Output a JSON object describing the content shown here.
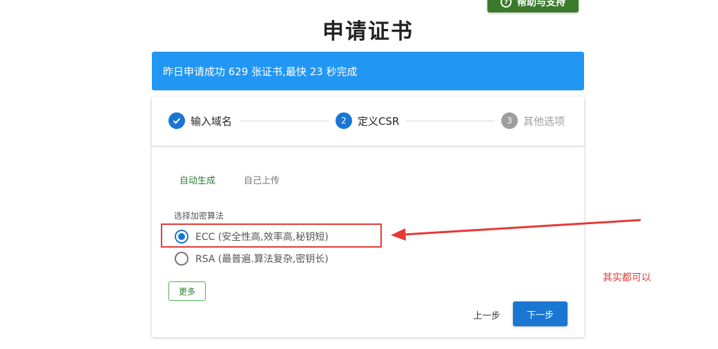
{
  "header": {
    "help_button": "帮助与支持",
    "title": "申请证书"
  },
  "banner": {
    "text": "昨日申请成功 629 张证书,最快 23 秒完成"
  },
  "stepper": {
    "steps": [
      {
        "index": "1",
        "label": "输入域名",
        "state": "done"
      },
      {
        "index": "2",
        "label": "定义CSR",
        "state": "active"
      },
      {
        "index": "3",
        "label": "其他选项",
        "state": "todo"
      }
    ]
  },
  "tabs": [
    {
      "label": "自动生成",
      "selected": true
    },
    {
      "label": "自己上传",
      "selected": false
    }
  ],
  "algorithm": {
    "label": "选择加密算法",
    "options": [
      {
        "label": "ECC (安全性高,效率高,秘钥短)",
        "checked": true
      },
      {
        "label": "RSA (最普遍.算法复杂,密钥长)",
        "checked": false
      }
    ]
  },
  "buttons": {
    "more": "更多",
    "prev": "上一步",
    "next": "下一步"
  },
  "annotation": {
    "note": "其实都可以"
  },
  "colors": {
    "primary": "#1976d2",
    "banner": "#2196f3",
    "help_green": "#3b7a2a",
    "tab_green": "#2e7d32",
    "annotation_red": "#e53935"
  }
}
